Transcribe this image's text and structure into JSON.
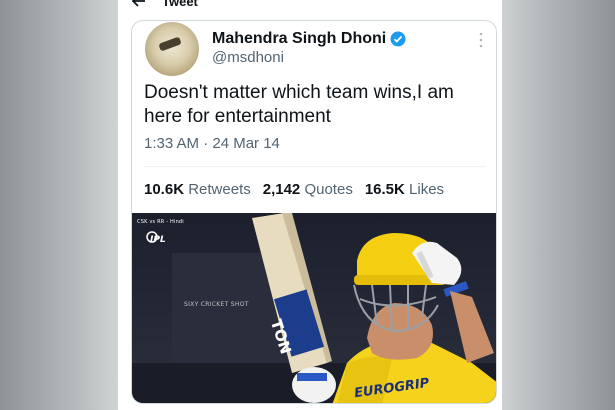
{
  "header": {
    "title": "Tweet"
  },
  "tweet": {
    "author_name": "Mahendra Singh Dhoni",
    "author_handle": "@msdhoni",
    "text": "Doesn't matter which team wins,I am here for entertainment",
    "timestamp": "1:33 AM · 24 Mar 14",
    "stats": [
      {
        "count": "10.6K",
        "label": "Retweets"
      },
      {
        "count": "2,142",
        "label": "Quotes"
      },
      {
        "count": "16.5K",
        "label": "Likes"
      }
    ]
  },
  "media": {
    "overlay_match": "CSK vs RR - Hindi",
    "overlay_league": "IPL",
    "watermark": "SIXY CRICKET SHOT",
    "bat_brand": "TON",
    "jersey_text": "EUROGRIP"
  },
  "icons": {
    "back": "arrow-left-icon",
    "verified": "verified-badge-icon",
    "more": "more-vertical-icon"
  },
  "colors": {
    "verified": "#1d9bf0",
    "text_primary": "#0f1419",
    "text_secondary": "#536471",
    "jersey": "#f5d21c"
  }
}
